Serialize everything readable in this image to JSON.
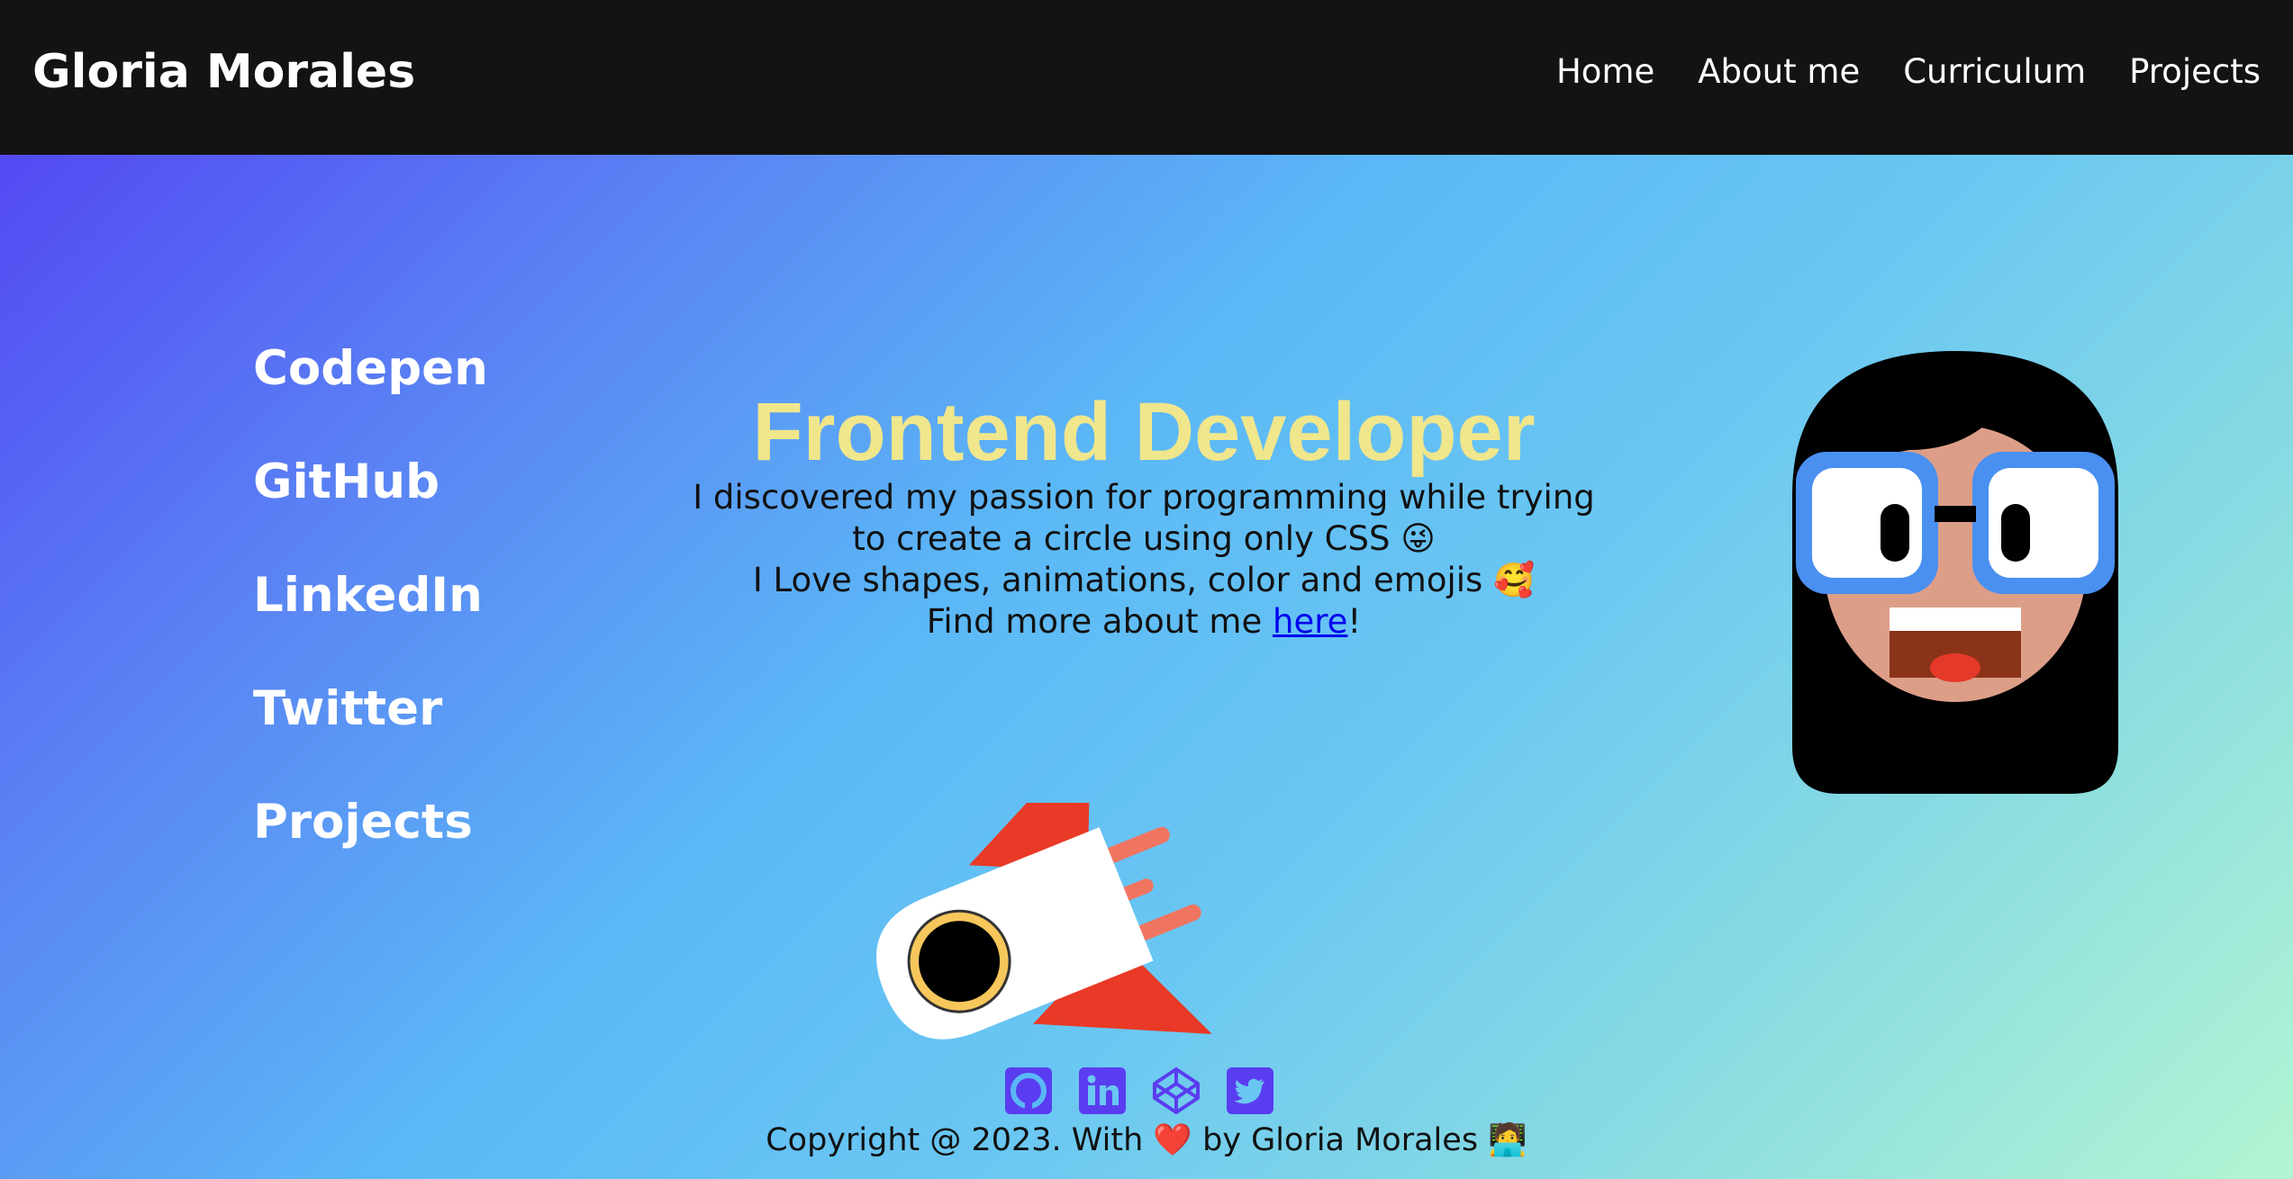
{
  "header": {
    "brand": "Gloria Morales",
    "nav": [
      "Home",
      "About me",
      "Curriculum",
      "Projects"
    ]
  },
  "sidebar_links": [
    "Codepen",
    "GitHub",
    "LinkedIn",
    "Twitter",
    "Projects"
  ],
  "intro": {
    "headline": "Frontend Developer",
    "line1": "I discovered my passion for programming while trying",
    "line2": "to create a circle using only CSS 😜",
    "line3": "I Love shapes, animations, color and emojis 🥰",
    "line4_before": "Find more about me ",
    "line4_link": "here",
    "line4_after": "!"
  },
  "footer": {
    "icons": [
      "github-icon",
      "linkedin-icon",
      "codepen-icon",
      "twitter-icon"
    ],
    "copyright": "Copyright @ 2023. With ❤️ by Gloria Morales 🧑‍💻"
  },
  "colors": {
    "header_bg": "#131313",
    "headline": "#f0e68c",
    "icon_purple": "#5a3df0",
    "link_blue": "#0000ee"
  }
}
